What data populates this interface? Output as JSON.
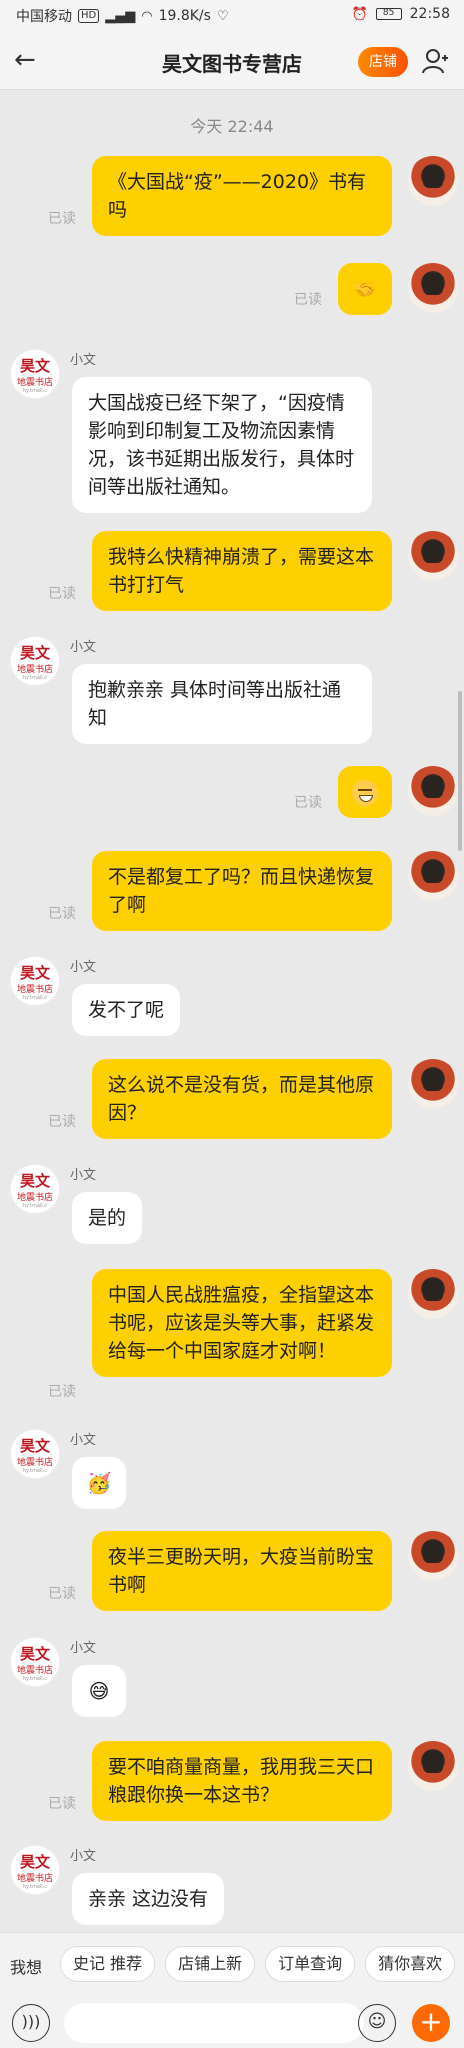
{
  "statusbar": {
    "carrier": "中国移动",
    "hd": "HD",
    "signal": "4G",
    "speed": "19.8K/s",
    "battery": "85",
    "time": "22:58"
  },
  "header": {
    "title": "昊文图书专营店",
    "shop_label": "店铺"
  },
  "chat": {
    "time": "今天 22:44",
    "read_label": "已读",
    "shop_name": "小文",
    "avatar_logo": {
      "line1": "昊文",
      "line2": "地震书店",
      "line3": "hy.tmall.c"
    },
    "messages": [
      {
        "side": "me",
        "text": "《大国战“疫”——2020》书有吗"
      },
      {
        "side": "me",
        "text": "",
        "icon": "handshake-emoji"
      },
      {
        "side": "them",
        "text": "大国战疫已经下架了，“因疫情影响到印制复工及物流因素情况，该书延期出版发行，具体时间等出版社通知。"
      },
      {
        "side": "me",
        "text": "我特么快精神崩溃了，需要这本书打打气"
      },
      {
        "side": "them",
        "text": "抱歉亲亲 具体时间等出版社通知"
      },
      {
        "side": "me",
        "text": "",
        "icon": "grimace-emoji"
      },
      {
        "side": "me",
        "text": "不是都复工了吗？而且快递恢复了啊"
      },
      {
        "side": "them",
        "text": "发不了呢"
      },
      {
        "side": "me",
        "text": "这么说不是没有货，而是其他原因？"
      },
      {
        "side": "them",
        "text": "是的"
      },
      {
        "side": "me",
        "text": "中国人民战胜瘟疫，全指望这本书呢，应该是头等大事，赶紧发给每一个中国家庭才对啊！"
      },
      {
        "side": "them",
        "text": "",
        "icon": "party-emoji"
      },
      {
        "side": "me",
        "text": "夜半三更盼天明，大疫当前盼宝书啊"
      },
      {
        "side": "them",
        "text": "",
        "icon": "sweat-emoji"
      },
      {
        "side": "me",
        "text": "要不咱商量商量，我用我三天口粮跟你换一本这书？"
      },
      {
        "side": "them",
        "text": "亲亲 这边没有"
      }
    ]
  },
  "quick": {
    "label": "我想",
    "chips": [
      "史记 推荐",
      "店铺上新",
      "订单查询",
      "猜你喜欢"
    ]
  },
  "inputbar": {
    "voice_icon": "voice-icon",
    "emoji_icon": "smile-icon",
    "plus_icon": "plus-icon"
  }
}
